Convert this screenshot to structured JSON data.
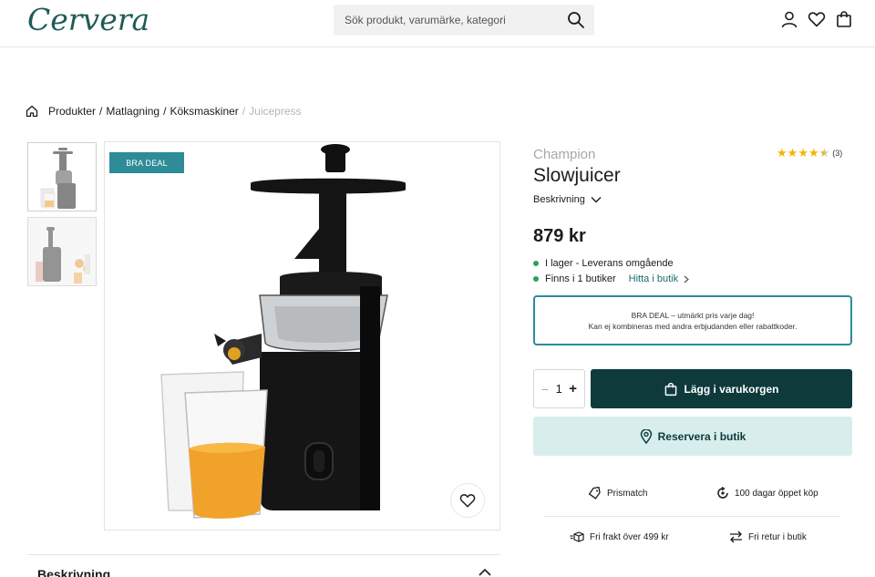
{
  "header": {
    "logo": "Cervera",
    "search_placeholder": "Sök produkt, varumärke, kategori",
    "icons": [
      "account-icon",
      "heart-icon",
      "bag-icon"
    ]
  },
  "breadcrumb": {
    "items": [
      "Produkter",
      "Matlagning",
      "Köksmaskiner"
    ],
    "separator": "/",
    "current": "Juicepress"
  },
  "gallery": {
    "badge": "BRA DEAL"
  },
  "product": {
    "brand": "Champion",
    "title": "Slowjuicer",
    "rating_value": 4.5,
    "rating_count": "(3)",
    "description_label": "Beskrivning",
    "price": "879 kr",
    "stock_text": "I lager - Leverans omgående",
    "stores_text": "Finns i 1 butiker",
    "find_store_label": "Hitta i butik"
  },
  "deal_box": {
    "line1": "BRA DEAL – utmärkt pris varje dag!",
    "line2": "Kan ej kombineras med andra erbjudanden eller rabattkoder."
  },
  "purchase": {
    "quantity": "1",
    "minus": "−",
    "plus": "+",
    "add_to_cart_label": "Lägg i varukorgen",
    "reserve_label": "Reservera i butik"
  },
  "usps": {
    "price_match": "Prismatch",
    "open_purchase": "100 dagar öppet köp",
    "free_shipping": "Fri frakt över 499 kr",
    "free_return": "Fri retur i butik"
  },
  "accordion": {
    "title": "Beskrivning"
  },
  "colors": {
    "brand_teal": "#1f5c58",
    "badge_teal": "#2e8b98",
    "cart_button": "#0e3a3c",
    "reserve_bg": "#d8eeec",
    "in_stock": "#29a35a",
    "star": "#f5b400"
  }
}
